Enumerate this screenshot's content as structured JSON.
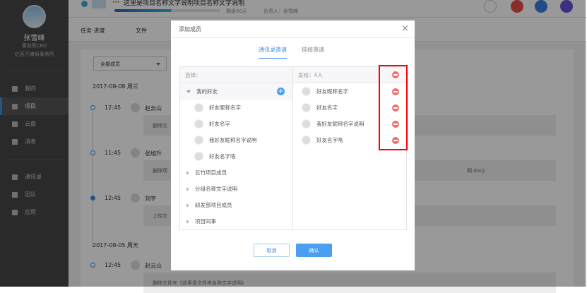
{
  "user": {
    "name": "张雪峰",
    "title": "事务所CEO",
    "company": "亿百万律师事务所"
  },
  "nav": [
    {
      "label": "我的"
    },
    {
      "label": "项目"
    },
    {
      "label": "云盘"
    },
    {
      "label": "消息"
    },
    {
      "label": "通讯录"
    },
    {
      "label": "团队"
    },
    {
      "label": "应用"
    }
  ],
  "project": {
    "title": "这里是项目名称文字说明项目名称文字说明",
    "progress_percent": 54,
    "remaining": "剩余50天",
    "owner": "负责人：张雪峰"
  },
  "tabs": [
    "任务·进度",
    "文件"
  ],
  "filter": "全部成员",
  "timeline": [
    {
      "date": "2017-08-08  周三"
    },
    {
      "time": "12:45",
      "name": "赵云山",
      "text": "删除文"
    },
    {
      "time": "11:45",
      "name": "张旭升",
      "text": "删除项",
      "text_tail": "明.doc》"
    },
    {
      "time": "12:45",
      "name": "刘宇",
      "text": "上传文"
    },
    {
      "date": "2017-08-05 周天"
    },
    {
      "time": "12:45",
      "name": "赵云山",
      "text": "删除文件夹《这里是文件夹名称文字说明》"
    }
  ],
  "modal": {
    "title": "添加成员",
    "close": "×",
    "tabs": [
      "通讯录邀请",
      "链接邀请"
    ],
    "left_header": "选择：",
    "group_open": "我的好友",
    "friends": [
      "好友昵称名字",
      "好友名字",
      "我好友昵称名字说明",
      "好友名字咯"
    ],
    "groups": [
      "云竹项目成员",
      "分组名称文字说明",
      "研发部项目成员",
      "项目同事"
    ],
    "right_header": "发给：4人",
    "selected": [
      "好友昵称名字",
      "好友名字",
      "我好友昵称名字说明",
      "好友名字咯"
    ],
    "cancel": "取消",
    "confirm": "确认"
  },
  "colors": {
    "accent": "#3b8fe0",
    "remove": "#f26d6d",
    "highlight": "#ff0000"
  }
}
